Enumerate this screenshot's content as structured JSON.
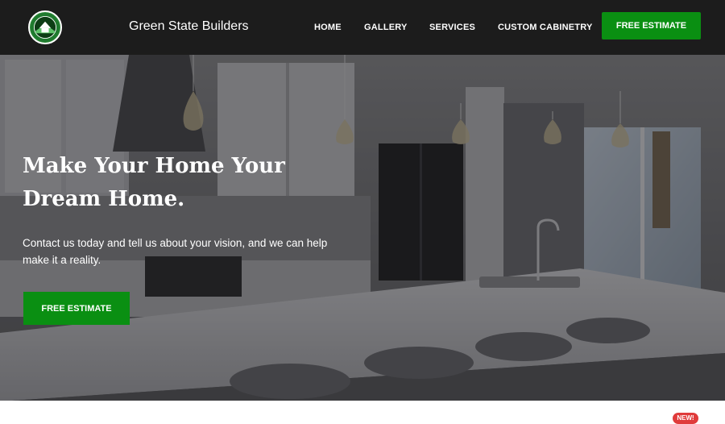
{
  "navbar": {
    "brand": "Green State Builders",
    "links": [
      "HOME",
      "GALLERY",
      "SERVICES",
      "CUSTOM CABINETRY"
    ],
    "cta_label": "FREE ESTIMATE"
  },
  "hero": {
    "title": "Make Your Home Your Dream Home.",
    "subtitle": "Contact us today and tell us about your vision, and we can help make it a reality.",
    "cta_label": "FREE ESTIMATE"
  },
  "badge": {
    "label": "NEW!"
  },
  "colors": {
    "nav_bg": "#1c1c1c",
    "accent_green": "#0a8f12",
    "badge_red": "#e03b3b"
  },
  "icons": {
    "logo": "green-state-builders-logo"
  }
}
